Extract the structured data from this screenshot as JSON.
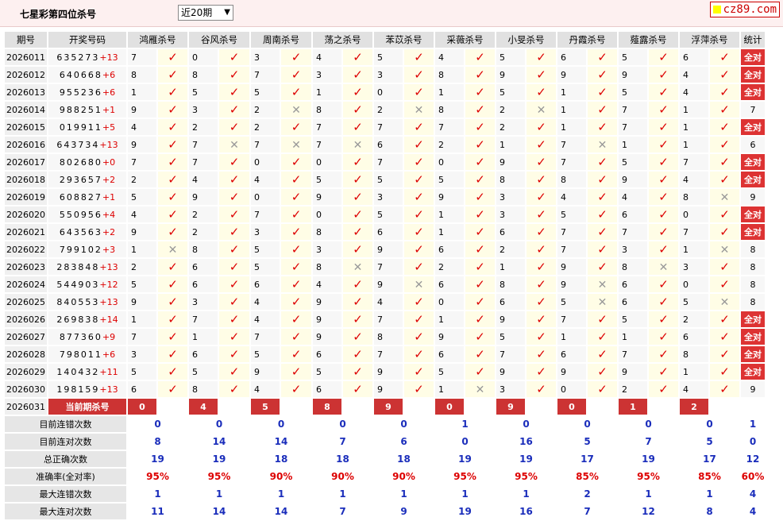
{
  "title": "七星彩第四位杀号",
  "period_select": "近20期",
  "logo": "cz89.com",
  "headers": [
    "期号",
    "开奖号码",
    "鸿雁杀号",
    "谷风杀号",
    "周南杀号",
    "荡之杀号",
    "苯苡杀号",
    "采薇杀号",
    "小旻杀号",
    "丹霞杀号",
    "薤露杀号",
    "浮萍杀号",
    "统计"
  ],
  "rows": [
    {
      "period": "2026011",
      "digits": "635273",
      "sum": "+13",
      "kills": [
        "7",
        "0",
        "3",
        "4",
        "5",
        "4",
        "5",
        "6",
        "5",
        "6"
      ],
      "hits": [
        1,
        1,
        1,
        1,
        1,
        1,
        1,
        1,
        1,
        1
      ],
      "stat": "全对"
    },
    {
      "period": "2026012",
      "digits": "640668",
      "sum": "+6",
      "kills": [
        "8",
        "8",
        "7",
        "3",
        "3",
        "8",
        "9",
        "9",
        "9",
        "4"
      ],
      "hits": [
        1,
        1,
        1,
        1,
        1,
        1,
        1,
        1,
        1,
        1
      ],
      "stat": "全对"
    },
    {
      "period": "2026013",
      "digits": "955236",
      "sum": "+6",
      "kills": [
        "1",
        "5",
        "5",
        "1",
        "0",
        "1",
        "5",
        "1",
        "5",
        "4"
      ],
      "hits": [
        1,
        1,
        1,
        1,
        1,
        1,
        1,
        1,
        1,
        1
      ],
      "stat": "全对"
    },
    {
      "period": "2026014",
      "digits": "988251",
      "sum": "+1",
      "kills": [
        "9",
        "3",
        "2",
        "8",
        "2",
        "8",
        "2",
        "1",
        "7",
        "1"
      ],
      "hits": [
        1,
        1,
        0,
        1,
        0,
        1,
        0,
        1,
        1,
        1
      ],
      "stat": "7"
    },
    {
      "period": "2026015",
      "digits": "019911",
      "sum": "+5",
      "kills": [
        "4",
        "2",
        "2",
        "7",
        "7",
        "7",
        "2",
        "1",
        "7",
        "1"
      ],
      "hits": [
        1,
        1,
        1,
        1,
        1,
        1,
        1,
        1,
        1,
        1
      ],
      "stat": "全对"
    },
    {
      "period": "2026016",
      "digits": "643734",
      "sum": "+13",
      "kills": [
        "9",
        "7",
        "7",
        "7",
        "6",
        "2",
        "1",
        "7",
        "1",
        "1"
      ],
      "hits": [
        1,
        0,
        0,
        0,
        1,
        1,
        1,
        0,
        1,
        1
      ],
      "stat": "6"
    },
    {
      "period": "2026017",
      "digits": "802680",
      "sum": "+0",
      "kills": [
        "7",
        "7",
        "0",
        "0",
        "7",
        "0",
        "9",
        "7",
        "5",
        "7"
      ],
      "hits": [
        1,
        1,
        1,
        1,
        1,
        1,
        1,
        1,
        1,
        1
      ],
      "stat": "全对"
    },
    {
      "period": "2026018",
      "digits": "293657",
      "sum": "+2",
      "kills": [
        "2",
        "4",
        "4",
        "5",
        "5",
        "5",
        "8",
        "8",
        "9",
        "4"
      ],
      "hits": [
        1,
        1,
        1,
        1,
        1,
        1,
        1,
        1,
        1,
        1
      ],
      "stat": "全对"
    },
    {
      "period": "2026019",
      "digits": "608827",
      "sum": "+1",
      "kills": [
        "5",
        "9",
        "0",
        "9",
        "3",
        "9",
        "3",
        "4",
        "4",
        "8"
      ],
      "hits": [
        1,
        1,
        1,
        1,
        1,
        1,
        1,
        1,
        1,
        0
      ],
      "stat": "9"
    },
    {
      "period": "2026020",
      "digits": "550956",
      "sum": "+4",
      "kills": [
        "4",
        "2",
        "7",
        "0",
        "5",
        "1",
        "3",
        "5",
        "6",
        "0"
      ],
      "hits": [
        1,
        1,
        1,
        1,
        1,
        1,
        1,
        1,
        1,
        1
      ],
      "stat": "全对"
    },
    {
      "period": "2026021",
      "digits": "643563",
      "sum": "+2",
      "kills": [
        "9",
        "2",
        "3",
        "8",
        "6",
        "1",
        "6",
        "7",
        "7",
        "7"
      ],
      "hits": [
        1,
        1,
        1,
        1,
        1,
        1,
        1,
        1,
        1,
        1
      ],
      "stat": "全对"
    },
    {
      "period": "2026022",
      "digits": "799102",
      "sum": "+3",
      "kills": [
        "1",
        "8",
        "5",
        "3",
        "9",
        "6",
        "2",
        "7",
        "3",
        "1"
      ],
      "hits": [
        0,
        1,
        1,
        1,
        1,
        1,
        1,
        1,
        1,
        0
      ],
      "stat": "8"
    },
    {
      "period": "2026023",
      "digits": "283848",
      "sum": "+13",
      "kills": [
        "2",
        "6",
        "5",
        "8",
        "7",
        "2",
        "1",
        "9",
        "8",
        "3"
      ],
      "hits": [
        1,
        1,
        1,
        0,
        1,
        1,
        1,
        1,
        0,
        1
      ],
      "stat": "8"
    },
    {
      "period": "2026024",
      "digits": "544903",
      "sum": "+12",
      "kills": [
        "5",
        "6",
        "6",
        "4",
        "9",
        "6",
        "8",
        "9",
        "6",
        "0"
      ],
      "hits": [
        1,
        1,
        1,
        1,
        0,
        1,
        1,
        0,
        1,
        1
      ],
      "stat": "8"
    },
    {
      "period": "2026025",
      "digits": "840553",
      "sum": "+13",
      "kills": [
        "9",
        "3",
        "4",
        "9",
        "4",
        "0",
        "6",
        "5",
        "6",
        "5"
      ],
      "hits": [
        1,
        1,
        1,
        1,
        1,
        1,
        1,
        0,
        1,
        0
      ],
      "stat": "8"
    },
    {
      "period": "2026026",
      "digits": "269838",
      "sum": "+14",
      "kills": [
        "1",
        "7",
        "4",
        "9",
        "7",
        "1",
        "9",
        "7",
        "5",
        "2"
      ],
      "hits": [
        1,
        1,
        1,
        1,
        1,
        1,
        1,
        1,
        1,
        1
      ],
      "stat": "全对"
    },
    {
      "period": "2026027",
      "digits": "877360",
      "sum": "+9",
      "kills": [
        "7",
        "1",
        "7",
        "9",
        "8",
        "9",
        "5",
        "1",
        "1",
        "6"
      ],
      "hits": [
        1,
        1,
        1,
        1,
        1,
        1,
        1,
        1,
        1,
        1
      ],
      "stat": "全对"
    },
    {
      "period": "2026028",
      "digits": "798011",
      "sum": "+6",
      "kills": [
        "3",
        "6",
        "5",
        "6",
        "7",
        "6",
        "7",
        "6",
        "7",
        "8"
      ],
      "hits": [
        1,
        1,
        1,
        1,
        1,
        1,
        1,
        1,
        1,
        1
      ],
      "stat": "全对"
    },
    {
      "period": "2026029",
      "digits": "140432",
      "sum": "+11",
      "kills": [
        "5",
        "5",
        "9",
        "5",
        "9",
        "5",
        "9",
        "9",
        "9",
        "1"
      ],
      "hits": [
        1,
        1,
        1,
        1,
        1,
        1,
        1,
        1,
        1,
        1
      ],
      "stat": "全对"
    },
    {
      "period": "2026030",
      "digits": "198159",
      "sum": "+13",
      "kills": [
        "6",
        "8",
        "4",
        "6",
        "9",
        "1",
        "3",
        "0",
        "2",
        "4"
      ],
      "hits": [
        1,
        1,
        1,
        1,
        1,
        0,
        1,
        1,
        1,
        1
      ],
      "stat": "9"
    }
  ],
  "current": {
    "period": "2026031",
    "label": "当前期杀号",
    "kills": [
      "0",
      "4",
      "5",
      "8",
      "9",
      "0",
      "9",
      "0",
      "1",
      "2"
    ]
  },
  "summary": [
    {
      "label": "目前连错次数",
      "values": [
        "0",
        "0",
        "0",
        "0",
        "0",
        "1",
        "0",
        "0",
        "0",
        "0",
        "1"
      ],
      "red": false
    },
    {
      "label": "目前连对次数",
      "values": [
        "8",
        "14",
        "14",
        "7",
        "6",
        "0",
        "16",
        "5",
        "7",
        "5",
        "0"
      ],
      "red": false
    },
    {
      "label": "总正确次数",
      "values": [
        "19",
        "19",
        "18",
        "18",
        "18",
        "19",
        "19",
        "17",
        "19",
        "17",
        "12"
      ],
      "red": false
    },
    {
      "label": "准确率(全对率)",
      "values": [
        "95%",
        "95%",
        "90%",
        "90%",
        "90%",
        "95%",
        "95%",
        "85%",
        "95%",
        "85%",
        "60%"
      ],
      "red": true
    },
    {
      "label": "最大连错次数",
      "values": [
        "1",
        "1",
        "1",
        "1",
        "1",
        "1",
        "1",
        "2",
        "1",
        "1",
        "4"
      ],
      "red": false
    },
    {
      "label": "最大连对次数",
      "values": [
        "11",
        "14",
        "14",
        "7",
        "9",
        "19",
        "16",
        "7",
        "12",
        "8",
        "4"
      ],
      "red": false
    }
  ],
  "icons": {
    "hit": "check-icon",
    "miss": "cross-icon"
  },
  "colors": {
    "hit": "#dd0000",
    "miss": "#999999",
    "badge": "#d33333",
    "summary_text": "#1a2dbb"
  }
}
